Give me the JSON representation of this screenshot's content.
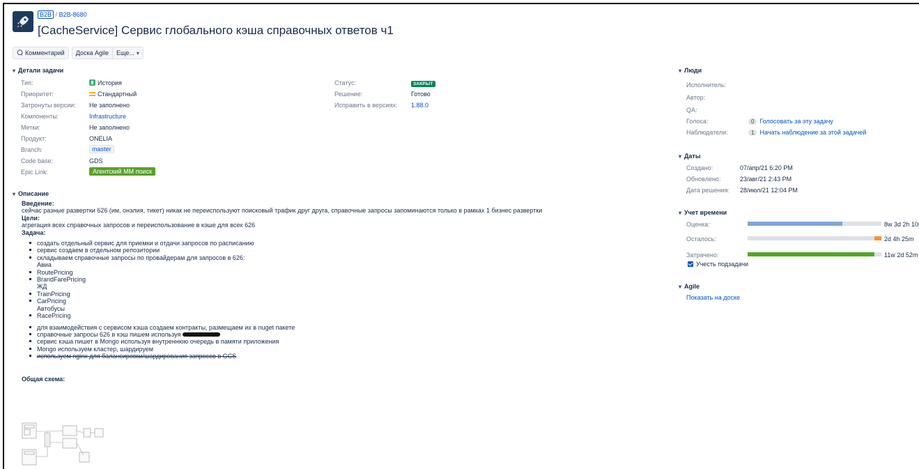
{
  "header": {
    "project_key": "B2B",
    "separator": "/",
    "issue_key": "B2B-8680",
    "title": "[CacheService] Сервис глобального кэша справочных ответов ч1"
  },
  "toolbar": {
    "comment": "Комментарий",
    "agile_board": "Доска Agile",
    "more": "Еще..."
  },
  "details": {
    "heading": "Детали задачи",
    "type_label": "Тип:",
    "type_value": "История",
    "priority_label": "Приоритет:",
    "priority_value": "Стандартный",
    "affects_label": "Затронуты версии:",
    "affects_value": "Не заполнено",
    "components_label": "Компоненты:",
    "components_value": "Infrastructure",
    "labels_label": "Метки:",
    "labels_value": "Не заполнено",
    "product_label": "Продукт:",
    "product_value": "ONELIA",
    "branch_label": "Branch:",
    "branch_value": "master",
    "codebase_label": "Code base:",
    "codebase_value": "GDS",
    "epic_label": "Epic Link:",
    "epic_value": "Агентский ММ поиск",
    "status_label": "Статус:",
    "status_value": "ЗАКРЫТ",
    "resolution_label": "Решение:",
    "resolution_value": "Готово",
    "fix_label": "Исправить в версиях:",
    "fix_value": "1.88.0"
  },
  "description": {
    "heading": "Описание",
    "intro_h": "Введение:",
    "intro": "сейчас разные развертки 626 (им, онэлия, тикет) никак не переиспользуют поисковый трафик друг друга, справочные запросы запоминаются только в рамках 1 бизнес развертки",
    "goals_h": "Цели:",
    "goals": "агрегация всех справочных запросов и переиспользование в кэше для всех 626",
    "task_h": "Задача:",
    "list1": [
      "создать отдельный сервис для приемки и отдачи запросов по расписанию",
      "сервис создаем в отдельном репозитории",
      "складываем справочные запросы по провайдерам для запросов в 626:"
    ],
    "avia": "Авиа",
    "avia_items": [
      "RoutePricing",
      "BrandFarePricing"
    ],
    "rail": "ЖД",
    "rail_items": [
      "TrainPricing",
      "CarPricing"
    ],
    "bus": "Автобусы",
    "bus_items": [
      "RacePricing"
    ],
    "list2": [
      "для взаимодействия с сервисом кэша создаем контракты, размещаем их в nuget пакете",
      "справочные запросы 626 в кэш пишем используя",
      "сервис кэша пишет в Mongo используя внутреннюю очередь в памяти приложения",
      "Mongo используем кластер, шардируем",
      "используем nginx для балансировки/шардирования запросов в GCS"
    ],
    "scheme_h": "Общая схема:"
  },
  "people": {
    "heading": "Люди",
    "assignee_label": "Исполнитель:",
    "reporter_label": "Автор:",
    "qa_label": "QA:",
    "votes_label": "Голоса:",
    "votes_count": "0",
    "votes_link": "Голосовать за эту задачу",
    "watchers_label": "Наблюдатели:",
    "watchers_count": "1",
    "watchers_link": "Начать наблюдение за этой задачей"
  },
  "dates": {
    "heading": "Даты",
    "created_label": "Создано:",
    "created_value": "07/апр/21 6:20 PM",
    "updated_label": "Обновлено:",
    "updated_value": "23/авг/21 2:43 PM",
    "resolved_label": "Дата решения:",
    "resolved_value": "28/июл/21 12:04 PM"
  },
  "time_tracking": {
    "heading": "Учет времени",
    "estimate_label": "Оценка:",
    "estimate_value": "8w 3d 2h 10m",
    "estimate_fraction": 0.71,
    "remaining_label": "Осталось:",
    "remaining_value": "2d 4h 25m",
    "remaining_fraction": 0.05,
    "logged_label": "Затрачено:",
    "logged_value": "11w 2d 52m",
    "logged_fraction": 0.95,
    "subtasks_label": "Учесть подзадачи",
    "colors": {
      "estimate": "#7ea7d8",
      "remaining": "#f79232",
      "logged": "#51a825",
      "track": "#dfe1e6"
    }
  },
  "agile": {
    "heading": "Agile",
    "link": "Показать на доске"
  }
}
